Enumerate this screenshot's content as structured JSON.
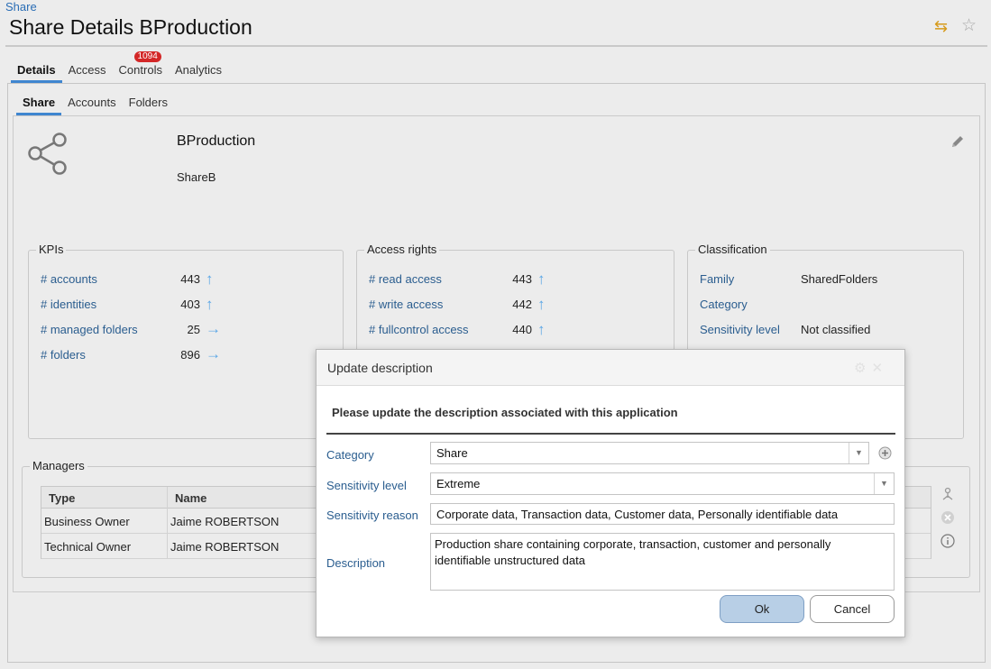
{
  "breadcrumb": "Share",
  "page_title": "Share Details BProduction",
  "tabs": [
    {
      "label": "Details",
      "active": true
    },
    {
      "label": "Access"
    },
    {
      "label": "Controls",
      "badge": "1094"
    },
    {
      "label": "Analytics"
    }
  ],
  "subtabs": [
    {
      "label": "Share",
      "active": true
    },
    {
      "label": "Accounts"
    },
    {
      "label": "Folders"
    }
  ],
  "share": {
    "name": "BProduction",
    "subtitle": "ShareB"
  },
  "kpis": {
    "legend": "KPIs",
    "rows": [
      {
        "label": "# accounts",
        "value": "443",
        "trend": "up"
      },
      {
        "label": "# identities",
        "value": "403",
        "trend": "up"
      },
      {
        "label": "# managed folders",
        "value": "25",
        "trend": "flat"
      },
      {
        "label": "# folders",
        "value": "896",
        "trend": "flat"
      }
    ]
  },
  "access_rights": {
    "legend": "Access rights",
    "rows": [
      {
        "label": "# read access",
        "value": "443",
        "trend": "up"
      },
      {
        "label": "# write access",
        "value": "442",
        "trend": "up"
      },
      {
        "label": "# fullcontrol access",
        "value": "440",
        "trend": "up"
      }
    ]
  },
  "classification": {
    "legend": "Classification",
    "rows": [
      {
        "label": "Family",
        "value": "SharedFolders"
      },
      {
        "label": "Category",
        "value": ""
      },
      {
        "label": "Sensitivity level",
        "value": "Not classified"
      }
    ]
  },
  "managers": {
    "legend": "Managers",
    "columns": [
      "Type",
      "Name"
    ],
    "rows": [
      {
        "type": "Business Owner",
        "name": "Jaime ROBERTSON"
      },
      {
        "type": "Technical Owner",
        "name": "Jaime ROBERTSON"
      }
    ]
  },
  "modal": {
    "title": "Update description",
    "intro": "Please update the description associated with this application",
    "category_label": "Category",
    "category_value": "Share",
    "sensitivity_level_label": "Sensitivity level",
    "sensitivity_level_value": "Extreme",
    "sensitivity_reason_label": "Sensitivity reason",
    "sensitivity_reason_value": "Corporate data, Transaction data, Customer data, Personally identifiable data",
    "description_label": "Description",
    "description_value": "Production share containing corporate, transaction, customer and personally identifiable unstructured data",
    "ok_label": "Ok",
    "cancel_label": "Cancel"
  },
  "colors": {
    "accent": "#3f86d0",
    "link": "#2a5d8f",
    "badge": "#d32727",
    "ok_button": "#b8cfe6",
    "trend_arrow": "#5aa6e6",
    "sync_icon": "#d69a1a"
  },
  "icons": [
    "share-icon",
    "edit-icon",
    "sync-icon",
    "star-icon",
    "arrow-up-icon",
    "arrow-right-icon",
    "add-icon",
    "manager-icon",
    "remove-icon",
    "info-icon",
    "chevron-down-icon"
  ]
}
